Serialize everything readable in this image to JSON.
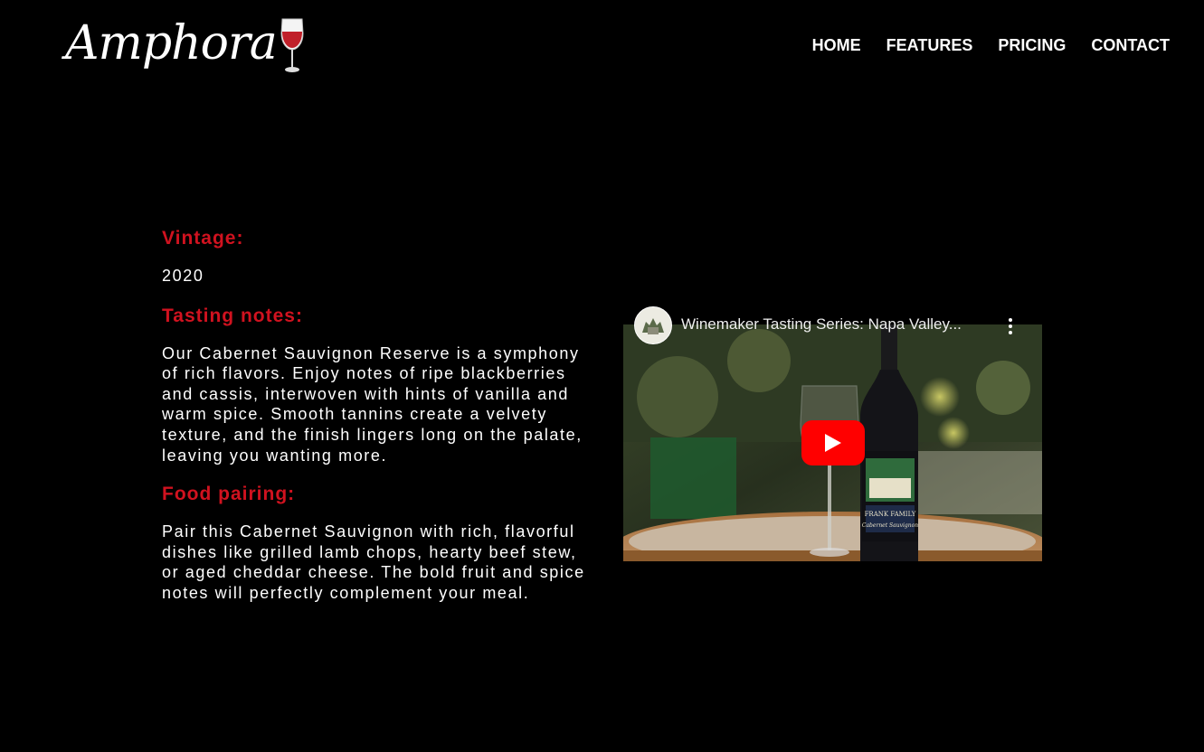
{
  "brand": {
    "logo_text": "Amphora",
    "wine_color": "#c0202a"
  },
  "nav": {
    "items": [
      {
        "label": "HOME"
      },
      {
        "label": "FEATURES"
      },
      {
        "label": "PRICING"
      },
      {
        "label": "CONTACT"
      }
    ]
  },
  "wine": {
    "vintage_label": "Vintage:",
    "vintage_value": "2020",
    "tasting_label": "Tasting notes:",
    "tasting_text": "Our Cabernet Sauvignon Reserve is a symphony of rich flavors. Enjoy notes of ripe blackberries and cassis, interwoven with hints of vanilla and warm spice. Smooth tannins create a velvety texture, and the finish lingers long on the palate, leaving you wanting more.",
    "food_label": "Food pairing:",
    "food_text": "Pair this Cabernet Sauvignon with rich, flavorful dishes like grilled lamb chops, hearty beef stew, or aged cheddar cheese. The bold fruit and spice notes will perfectly complement your meal."
  },
  "video": {
    "title": "Winemaker Tasting Series: Napa Valley...",
    "play_icon": "play-icon",
    "menu_icon": "kebab-menu-icon",
    "play_color": "#ff0000"
  },
  "colors": {
    "accent": "#d0121f",
    "background": "#000000",
    "text": "#ffffff"
  }
}
